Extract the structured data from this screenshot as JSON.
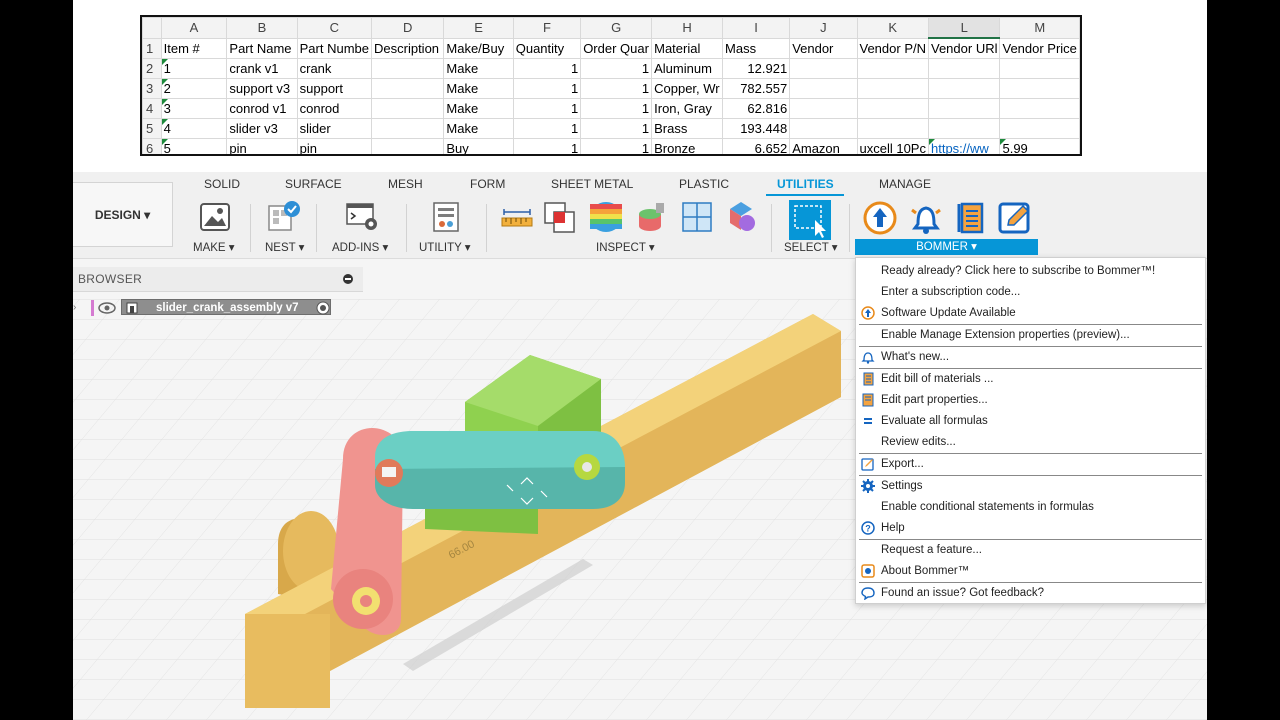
{
  "spreadsheet": {
    "columns": [
      "A",
      "B",
      "C",
      "D",
      "E",
      "F",
      "G",
      "H",
      "I",
      "J",
      "K",
      "L",
      "M"
    ],
    "headers": [
      "Item #",
      "Part Name",
      "Part Numbe",
      "Description",
      "Make/Buy",
      "Quantity",
      "Order Quar",
      "Material",
      "Mass",
      "Vendor",
      "Vendor P/N",
      "Vendor URl",
      "Vendor Price"
    ],
    "rows": [
      {
        "num": "2",
        "cells": [
          "1",
          "crank v1",
          "crank",
          "",
          "Make",
          "1",
          "1",
          "Aluminum",
          "12.921",
          "",
          "",
          "",
          ""
        ]
      },
      {
        "num": "3",
        "cells": [
          "2",
          "support v3",
          "support",
          "",
          "Make",
          "1",
          "1",
          "Copper, Wr",
          "782.557",
          "",
          "",
          "",
          ""
        ]
      },
      {
        "num": "4",
        "cells": [
          "3",
          "conrod v1",
          "conrod",
          "",
          "Make",
          "1",
          "1",
          "Iron, Gray",
          "62.816",
          "",
          "",
          "",
          ""
        ]
      },
      {
        "num": "5",
        "cells": [
          "4",
          "slider v3",
          "slider",
          "",
          "Make",
          "1",
          "1",
          "Brass",
          "193.448",
          "",
          "",
          "",
          ""
        ]
      },
      {
        "num": "6",
        "cells": [
          "5",
          "pin",
          "pin",
          "",
          "Buy",
          "1",
          "1",
          "Bronze",
          "6.652",
          "Amazon",
          "uxcell 10Pc",
          "https://ww",
          "5.99"
        ]
      }
    ],
    "header_row_num": "1"
  },
  "workspace": {
    "design_label": "DESIGN"
  },
  "tabs": [
    "SOLID",
    "SURFACE",
    "MESH",
    "FORM",
    "SHEET METAL",
    "PLASTIC",
    "UTILITIES",
    "MANAGE"
  ],
  "groups": {
    "make": "MAKE",
    "nest": "NEST",
    "addins": "ADD-INS",
    "utility": "UTILITY",
    "inspect": "INSPECT",
    "select": "SELECT",
    "bommer": "BOMMER"
  },
  "browser": {
    "title": "BROWSER",
    "component": "slider_crank_assembly v7"
  },
  "menu": {
    "items": [
      {
        "label": "Ready already?  Click here to subscribe to Bommer™!",
        "icon": ""
      },
      {
        "label": "Enter a subscription code...",
        "icon": ""
      },
      {
        "label": "Software Update Available",
        "icon": "update-icon"
      },
      {
        "label": "Enable Manage Extension properties (preview)...",
        "icon": ""
      },
      {
        "label": "What's new...",
        "icon": "bell-icon"
      },
      {
        "label": "Edit bill of materials ...",
        "icon": "bom-icon"
      },
      {
        "label": "Edit part properties...",
        "icon": "properties-icon"
      },
      {
        "label": "Evaluate all formulas",
        "icon": "equals-icon"
      },
      {
        "label": "Review edits...",
        "icon": ""
      },
      {
        "label": "Export...",
        "icon": "export-icon"
      },
      {
        "label": "Settings",
        "icon": "gear-icon"
      },
      {
        "label": "Enable conditional statements in formulas",
        "icon": ""
      },
      {
        "label": "Help",
        "icon": "help-icon"
      },
      {
        "label": "Request a feature...",
        "icon": ""
      },
      {
        "label": "About Bommer™",
        "icon": "about-icon"
      },
      {
        "label": "Found an issue?  Got feedback?",
        "icon": "feedback-icon"
      }
    ]
  },
  "viewport": {
    "dimension_label": "66.00"
  },
  "colors": {
    "accent": "#0696d7",
    "slider": "#8fd14f",
    "rail": "#edc66a",
    "crank": "#f0948f",
    "conrod": "#6bcfc4"
  }
}
